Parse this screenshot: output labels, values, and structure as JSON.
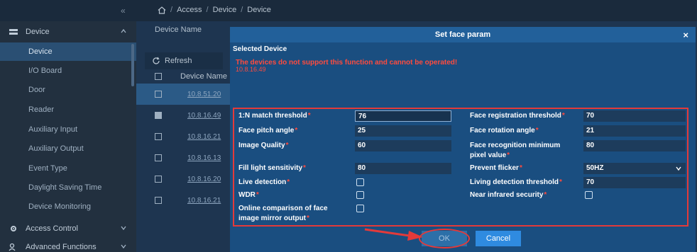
{
  "breadcrumb": {
    "items": [
      "Access",
      "Device",
      "Device"
    ],
    "separator": "/"
  },
  "sidebar": {
    "collapse_glyph": "«",
    "group": "Device",
    "items": [
      "Device",
      "I/O Board",
      "Door",
      "Reader",
      "Auxiliary Input",
      "Auxiliary Output",
      "Event Type",
      "Daylight Saving Time",
      "Device Monitoring"
    ],
    "bottom_groups": [
      "Access Control",
      "Advanced Functions"
    ]
  },
  "main": {
    "header": "Device Name",
    "refresh_label": "Refresh",
    "column_device_name": "Device Name",
    "rows": [
      {
        "ip": "10.8.51.20",
        "checked": false,
        "selected": true
      },
      {
        "ip": "10.8.16.49",
        "checked": true,
        "selected": false
      },
      {
        "ip": "10.8.16.21",
        "checked": false,
        "selected": false
      },
      {
        "ip": "10.8.16.13",
        "checked": false,
        "selected": false
      },
      {
        "ip": "10.8.16.20",
        "checked": false,
        "selected": false
      },
      {
        "ip": "10.8.16.21",
        "checked": false,
        "selected": false
      }
    ]
  },
  "modal": {
    "title": "Set face param",
    "close_glyph": "×",
    "selected_heading": "Selected Device",
    "error_message": "The devices do not support this function and cannot be operated!",
    "error_device": "10.8.16.49",
    "fields": {
      "match_threshold_label": "1:N match threshold",
      "match_threshold_value": "76",
      "face_reg_threshold_label": "Face registration threshold",
      "face_reg_threshold_value": "70",
      "pitch_angle_label": "Face pitch angle",
      "pitch_angle_value": "25",
      "rotation_angle_label": "Face rotation angle",
      "rotation_angle_value": "21",
      "image_quality_label": "Image Quality",
      "image_quality_value": "60",
      "min_pixel_label_line1": "Face recognition minimum",
      "min_pixel_label_line2": "pixel value",
      "min_pixel_value": "80",
      "fill_light_label": "Fill light sensitivity",
      "fill_light_value": "80",
      "prevent_flicker_label": "Prevent flicker",
      "prevent_flicker_value": "50HZ",
      "live_detection_label": "Live detection",
      "living_threshold_label": "Living detection threshold",
      "living_threshold_value": "70",
      "wdr_label": "WDR",
      "near_infrared_label": "Near infrared security",
      "mirror_label_line1": "Online comparison of face",
      "mirror_label_line2": "image mirror output"
    },
    "ok_label": "OK",
    "cancel_label": "Cancel"
  },
  "colors": {
    "accent": "#2f8be0",
    "error": "#ff4b3e",
    "highlight": "#e33a3a"
  }
}
